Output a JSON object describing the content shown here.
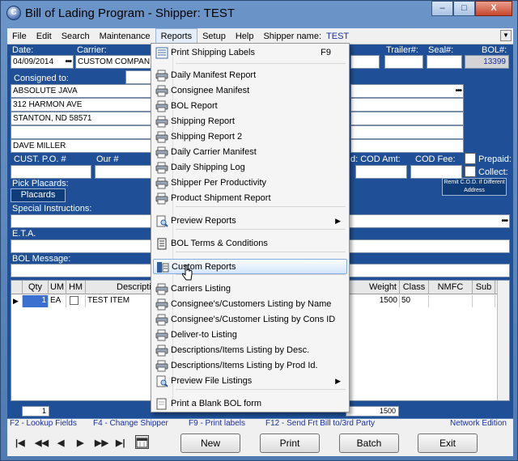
{
  "window": {
    "title": "Bill of Lading Program - Shipper: TEST",
    "minimize": "–",
    "maximize": "□",
    "close": "X"
  },
  "menubar": {
    "items": [
      "File",
      "Edit",
      "Search",
      "Maintenance",
      "Reports",
      "Setup",
      "Help"
    ],
    "shipper_label": "Shipper name:",
    "shipper_name": "TEST"
  },
  "form": {
    "date_label": "Date:",
    "date_value": "04/09/2014",
    "carrier_label": "Carrier:",
    "carrier_value": "CUSTOM COMPANIES",
    "trailer_label": "Trailer#:",
    "seal_label": "Seal#:",
    "bol_label": "BOL#:",
    "bol_value": "13399",
    "consigned_label": "Consigned to:",
    "consignee_lines": [
      "ABSOLUTE JAVA",
      "312 HARMON AVE",
      "STANTON, ND 58571",
      "",
      "DAVE MILLER"
    ],
    "cust_po_label": "CUST. P.O. #",
    "our_label": "Our #",
    "cod_amt_label": "d: COD Amt:",
    "cod_fee_label": "COD Fee:",
    "prepaid_label": "Prepaid:",
    "collect_label": "Collect:",
    "pick_placards_label": "Pick Placards:",
    "placards_button": "Placards",
    "remit_button": "Remit C.O.D. if Different Address",
    "special_instructions_label": "Special Instructions:",
    "eta_label": "E.T.A.",
    "bol_message_label": "BOL Message:",
    "dots": "•••"
  },
  "grid": {
    "columns": [
      "Qty",
      "UM",
      "HM",
      "Descripti",
      "Weight",
      "Class",
      "NMFC",
      "Sub"
    ],
    "rows": [
      {
        "qty": "1",
        "um": "EA",
        "hm": "",
        "desc": "TEST ITEM",
        "weight": "1500",
        "class": "50",
        "nmfc": "",
        "sub": ""
      }
    ],
    "total_qty": "1",
    "total_weight": "1500"
  },
  "fkeys": [
    "F2 - Lookup Fields",
    "F4 - Change Shipper",
    "F9 - Print labels",
    "F12 - Send Frt Bill to/3rd Party",
    "Network Edition"
  ],
  "bottom": {
    "nav": [
      "|◀",
      "◀◀",
      "◀",
      "▶",
      "▶▶",
      "▶|"
    ],
    "buttons": [
      "New",
      "Print",
      "Batch",
      "Exit"
    ]
  },
  "reports_menu": {
    "items": [
      {
        "label": "Print Shipping Labels",
        "shortcut": "F9",
        "icon": "labels-icon"
      },
      {
        "label": "Daily Manifest Report",
        "icon": "printer-icon"
      },
      {
        "label": "Consignee Manifest",
        "icon": "printer-icon"
      },
      {
        "label": "BOL Report",
        "icon": "printer-icon"
      },
      {
        "label": "Shipping Report",
        "icon": "printer-icon"
      },
      {
        "label": "Shipping Report 2",
        "icon": "printer-icon"
      },
      {
        "label": "Daily Carrier Manifest",
        "icon": "printer-icon"
      },
      {
        "label": "Daily Shipping Log",
        "icon": "printer-icon"
      },
      {
        "label": "Shipper Per Productivity",
        "icon": "printer-icon"
      },
      {
        "label": "Product Shipment Report",
        "icon": "printer-icon"
      },
      {
        "label": "Preview Reports",
        "icon": "preview-icon",
        "submenu": "▶"
      },
      {
        "label": "BOL Terms & Conditions",
        "icon": "document-icon"
      },
      {
        "label": "Custom Reports",
        "icon": "custom-report-icon"
      },
      {
        "label": "Carriers Listing",
        "icon": "printer-icon"
      },
      {
        "label": "Consignee's/Customers Listing by Name",
        "icon": "printer-icon"
      },
      {
        "label": "Consignee's/Customer Listing by Cons ID",
        "icon": "printer-icon"
      },
      {
        "label": "Deliver-to Listing",
        "icon": "printer-icon"
      },
      {
        "label": "Descriptions/Items Listing by Desc.",
        "icon": "printer-icon"
      },
      {
        "label": "Descriptions/Items Listing by Prod Id.",
        "icon": "printer-icon"
      },
      {
        "label": "Preview File Listings",
        "icon": "preview-icon",
        "submenu": "▶"
      },
      {
        "label": "Print a Blank BOL form",
        "icon": "blank-form-icon"
      }
    ]
  }
}
